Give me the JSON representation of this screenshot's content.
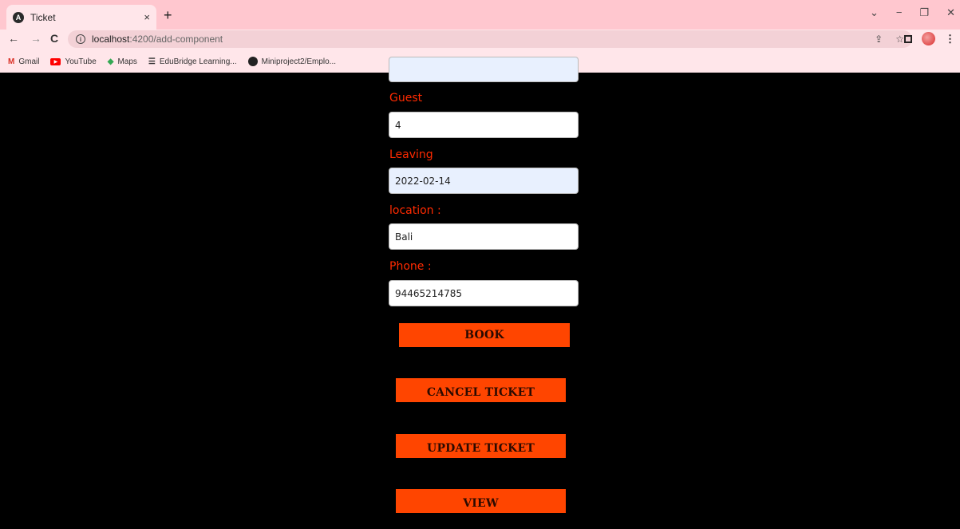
{
  "browser": {
    "tab": {
      "title": "Ticket",
      "close": "×"
    },
    "new_tab": "+",
    "window_controls": {
      "dropdown": "⌄",
      "minimize": "−",
      "restore": "❐",
      "close": "✕"
    },
    "nav": {
      "back": "←",
      "forward": "→",
      "reload": "C"
    },
    "url": {
      "host": "localhost",
      "path": ":4200/add-component"
    },
    "bookmarks": [
      {
        "label": "Gmail"
      },
      {
        "label": "YouTube"
      },
      {
        "label": "Maps"
      },
      {
        "label": "EduBridge Learning..."
      },
      {
        "label": "Miniproject2/Emplo..."
      }
    ]
  },
  "form": {
    "fields": [
      {
        "label": "",
        "value": ""
      },
      {
        "label": "Guest",
        "value": "4"
      },
      {
        "label": "Leaving",
        "value": "2022-02-14"
      },
      {
        "label": "location :",
        "value": "Bali"
      },
      {
        "label": "Phone :",
        "value": "94465214785"
      }
    ],
    "buttons": {
      "book": "BOOK",
      "cancel": "CANCEL TICKET",
      "update": "UPDATE TICKET",
      "view": "VIEW"
    }
  },
  "colors": {
    "accent": "#ff4500",
    "label": "#ff2a00",
    "chrome": "#ffc7cf"
  }
}
